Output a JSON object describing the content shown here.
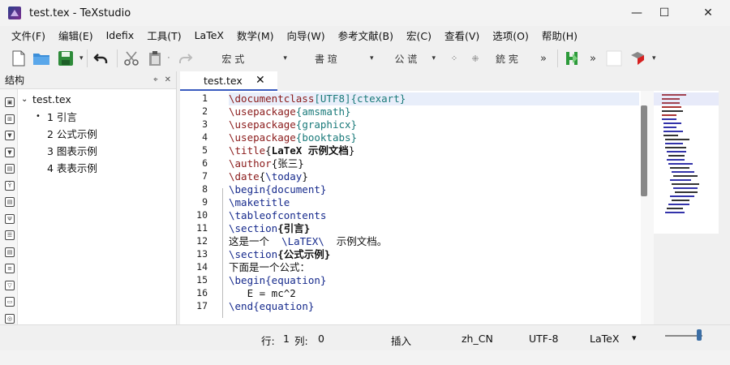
{
  "window": {
    "title": "test.tex - TeXstudio",
    "controls": {
      "minimize": "—",
      "maximize": "☐",
      "close": "✕"
    }
  },
  "menu": [
    "文件(F)",
    "编辑(E)",
    "Idefix",
    "工具(T)",
    "LaTeX",
    "数学(M)",
    "向导(W)",
    "参考文献(B)",
    "宏(C)",
    "查看(V)",
    "选项(O)",
    "帮助(H)"
  ],
  "toolbar": {
    "combo1": "宏 式",
    "combo2": "書 瑄",
    "combo3": "公 谎",
    "combo4": "銃 宪",
    "overflow": "»",
    "icons": [
      "new-file",
      "open-folder",
      "save",
      "undo",
      "cut",
      "paste",
      "redo",
      "build-run",
      "pdf-view"
    ]
  },
  "structure": {
    "title": "结构",
    "pin": "⌖",
    "close": "✕",
    "tree": [
      {
        "label": "test.tex",
        "level": 0,
        "expander": "⌄"
      },
      {
        "label": "1  引言",
        "level": 1,
        "expander": "•"
      },
      {
        "label": "2  公式示例",
        "level": 1,
        "expander": ""
      },
      {
        "label": "3  图表示例",
        "level": 1,
        "expander": ""
      },
      {
        "label": "4  表表示例",
        "level": 1,
        "expander": ""
      }
    ]
  },
  "editor": {
    "tab": {
      "label": "test.tex",
      "close": "✕"
    },
    "line_numbers": [
      "1",
      "2",
      "3",
      "4",
      "5",
      "6",
      "7",
      "8",
      "9",
      "10",
      "11",
      "12",
      "13",
      "14",
      "15",
      "16",
      "17"
    ],
    "lines": [
      [
        {
          "t": "\\documentclass",
          "c": "cmd"
        },
        {
          "t": "[UTF8]",
          "c": "arg"
        },
        {
          "t": "{ctexart}",
          "c": "arg"
        }
      ],
      [
        {
          "t": "\\usepackage",
          "c": "cmd"
        },
        {
          "t": "{amsmath}",
          "c": "arg"
        }
      ],
      [
        {
          "t": "\\usepackage",
          "c": "cmd"
        },
        {
          "t": "{graphicx}",
          "c": "arg"
        }
      ],
      [
        {
          "t": "\\usepackage",
          "c": "cmd"
        },
        {
          "t": "{booktabs}",
          "c": "arg"
        }
      ],
      [
        {
          "t": "\\title",
          "c": "cmd"
        },
        {
          "t": "{",
          "c": "txt"
        },
        {
          "t": "LaTeX 示例文档",
          "c": "txt bold"
        },
        {
          "t": "}",
          "c": "txt"
        }
      ],
      [
        {
          "t": "\\author",
          "c": "cmd"
        },
        {
          "t": "{张三}",
          "c": "txt"
        }
      ],
      [
        {
          "t": "\\date",
          "c": "cmd"
        },
        {
          "t": "{",
          "c": "txt"
        },
        {
          "t": "\\today",
          "c": "cmdb"
        },
        {
          "t": "}",
          "c": "txt"
        }
      ],
      [
        {
          "t": "\\begin",
          "c": "cmdb"
        },
        {
          "t": "{document}",
          "c": "cmdb"
        }
      ],
      [
        {
          "t": "\\maketitle",
          "c": "cmdb"
        }
      ],
      [
        {
          "t": "\\tableofcontents",
          "c": "cmdb"
        }
      ],
      [
        {
          "t": "\\section",
          "c": "cmdb"
        },
        {
          "t": "{引言}",
          "c": "txt bold"
        }
      ],
      [
        {
          "t": "这是一个  ",
          "c": "txt"
        },
        {
          "t": "\\LaTEX\\",
          "c": "cmdb"
        },
        {
          "t": "  示例文档。",
          "c": "txt"
        }
      ],
      [
        {
          "t": "\\section",
          "c": "cmdb"
        },
        {
          "t": "{公式示例}",
          "c": "txt bold"
        }
      ],
      [
        {
          "t": "下面是一个公式：",
          "c": "txt"
        }
      ],
      [
        {
          "t": "\\begin",
          "c": "cmdb"
        },
        {
          "t": "{equation}",
          "c": "cmdb"
        }
      ],
      [
        {
          "t": "   E = mc^2",
          "c": "txt"
        }
      ],
      [
        {
          "t": "\\end",
          "c": "cmdb"
        },
        {
          "t": "{equation}",
          "c": "cmdb"
        }
      ]
    ]
  },
  "status": {
    "line_label": "行:",
    "line_value": "1",
    "col_label": "列:",
    "col_value": "0",
    "mode": "插入",
    "language": "zh_CN",
    "encoding": "UTF-8",
    "format": "LaTeX",
    "format_dropdown": "▾"
  }
}
